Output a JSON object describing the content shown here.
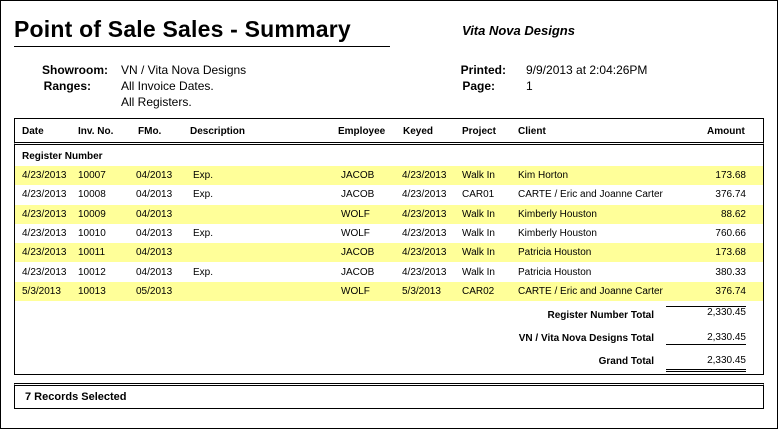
{
  "report": {
    "title": "Point of Sale Sales - Summary",
    "company": "Vita Nova Designs",
    "showroom_label": "Showroom:",
    "showroom_value": "VN / Vita Nova Designs",
    "ranges_label": "Ranges:",
    "ranges_value_1": "All Invoice Dates.",
    "ranges_value_2": "All Registers.",
    "printed_label": "Printed:",
    "printed_value": "9/9/2013 at 2:04:26PM",
    "page_label": "Page:",
    "page_value": "1"
  },
  "columns": {
    "date": "Date",
    "inv_no": "Inv. No.",
    "fmo": "FMo.",
    "description": "Description",
    "employee": "Employee",
    "keyed": "Keyed",
    "project": "Project",
    "client": "Client",
    "amount": "Amount"
  },
  "group_label": "Register Number",
  "rows": [
    {
      "date": "4/23/2013",
      "inv": "10007",
      "fmo": "04/2013",
      "desc": "Exp.",
      "emp": "JACOB",
      "keyed": "4/23/2013",
      "project": "Walk In",
      "client": "Kim Horton",
      "amount": "173.68"
    },
    {
      "date": "4/23/2013",
      "inv": "10008",
      "fmo": "04/2013",
      "desc": "Exp.",
      "emp": "JACOB",
      "keyed": "4/23/2013",
      "project": "CAR01",
      "client": "CARTE / Eric and Joanne Carter",
      "amount": "376.74"
    },
    {
      "date": "4/23/2013",
      "inv": "10009",
      "fmo": "04/2013",
      "desc": "",
      "emp": "WOLF",
      "keyed": "4/23/2013",
      "project": "Walk In",
      "client": "Kimberly Houston",
      "amount": "88.62"
    },
    {
      "date": "4/23/2013",
      "inv": "10010",
      "fmo": "04/2013",
      "desc": "Exp.",
      "emp": "WOLF",
      "keyed": "4/23/2013",
      "project": "Walk In",
      "client": "Kimberly Houston",
      "amount": "760.66"
    },
    {
      "date": "4/23/2013",
      "inv": "10011",
      "fmo": "04/2013",
      "desc": "",
      "emp": "JACOB",
      "keyed": "4/23/2013",
      "project": "Walk In",
      "client": "Patricia Houston",
      "amount": "173.68"
    },
    {
      "date": "4/23/2013",
      "inv": "10012",
      "fmo": "04/2013",
      "desc": "Exp.",
      "emp": "JACOB",
      "keyed": "4/23/2013",
      "project": "Walk In",
      "client": "Patricia Houston",
      "amount": "380.33"
    },
    {
      "date": "5/3/2013",
      "inv": "10013",
      "fmo": "05/2013",
      "desc": "",
      "emp": "WOLF",
      "keyed": "5/3/2013",
      "project": "CAR02",
      "client": "CARTE / Eric and Joanne Carter",
      "amount": "376.74"
    }
  ],
  "totals": {
    "register_label": "Register Number  Total",
    "register_value": "2,330.45",
    "showroom_label": "VN / Vita Nova Designs Total",
    "showroom_value": "2,330.45",
    "grand_label": "Grand Total",
    "grand_value": "2,330.45"
  },
  "footer": {
    "records": "7 Records Selected"
  },
  "colors": {
    "row_highlight": "#ffff99"
  }
}
